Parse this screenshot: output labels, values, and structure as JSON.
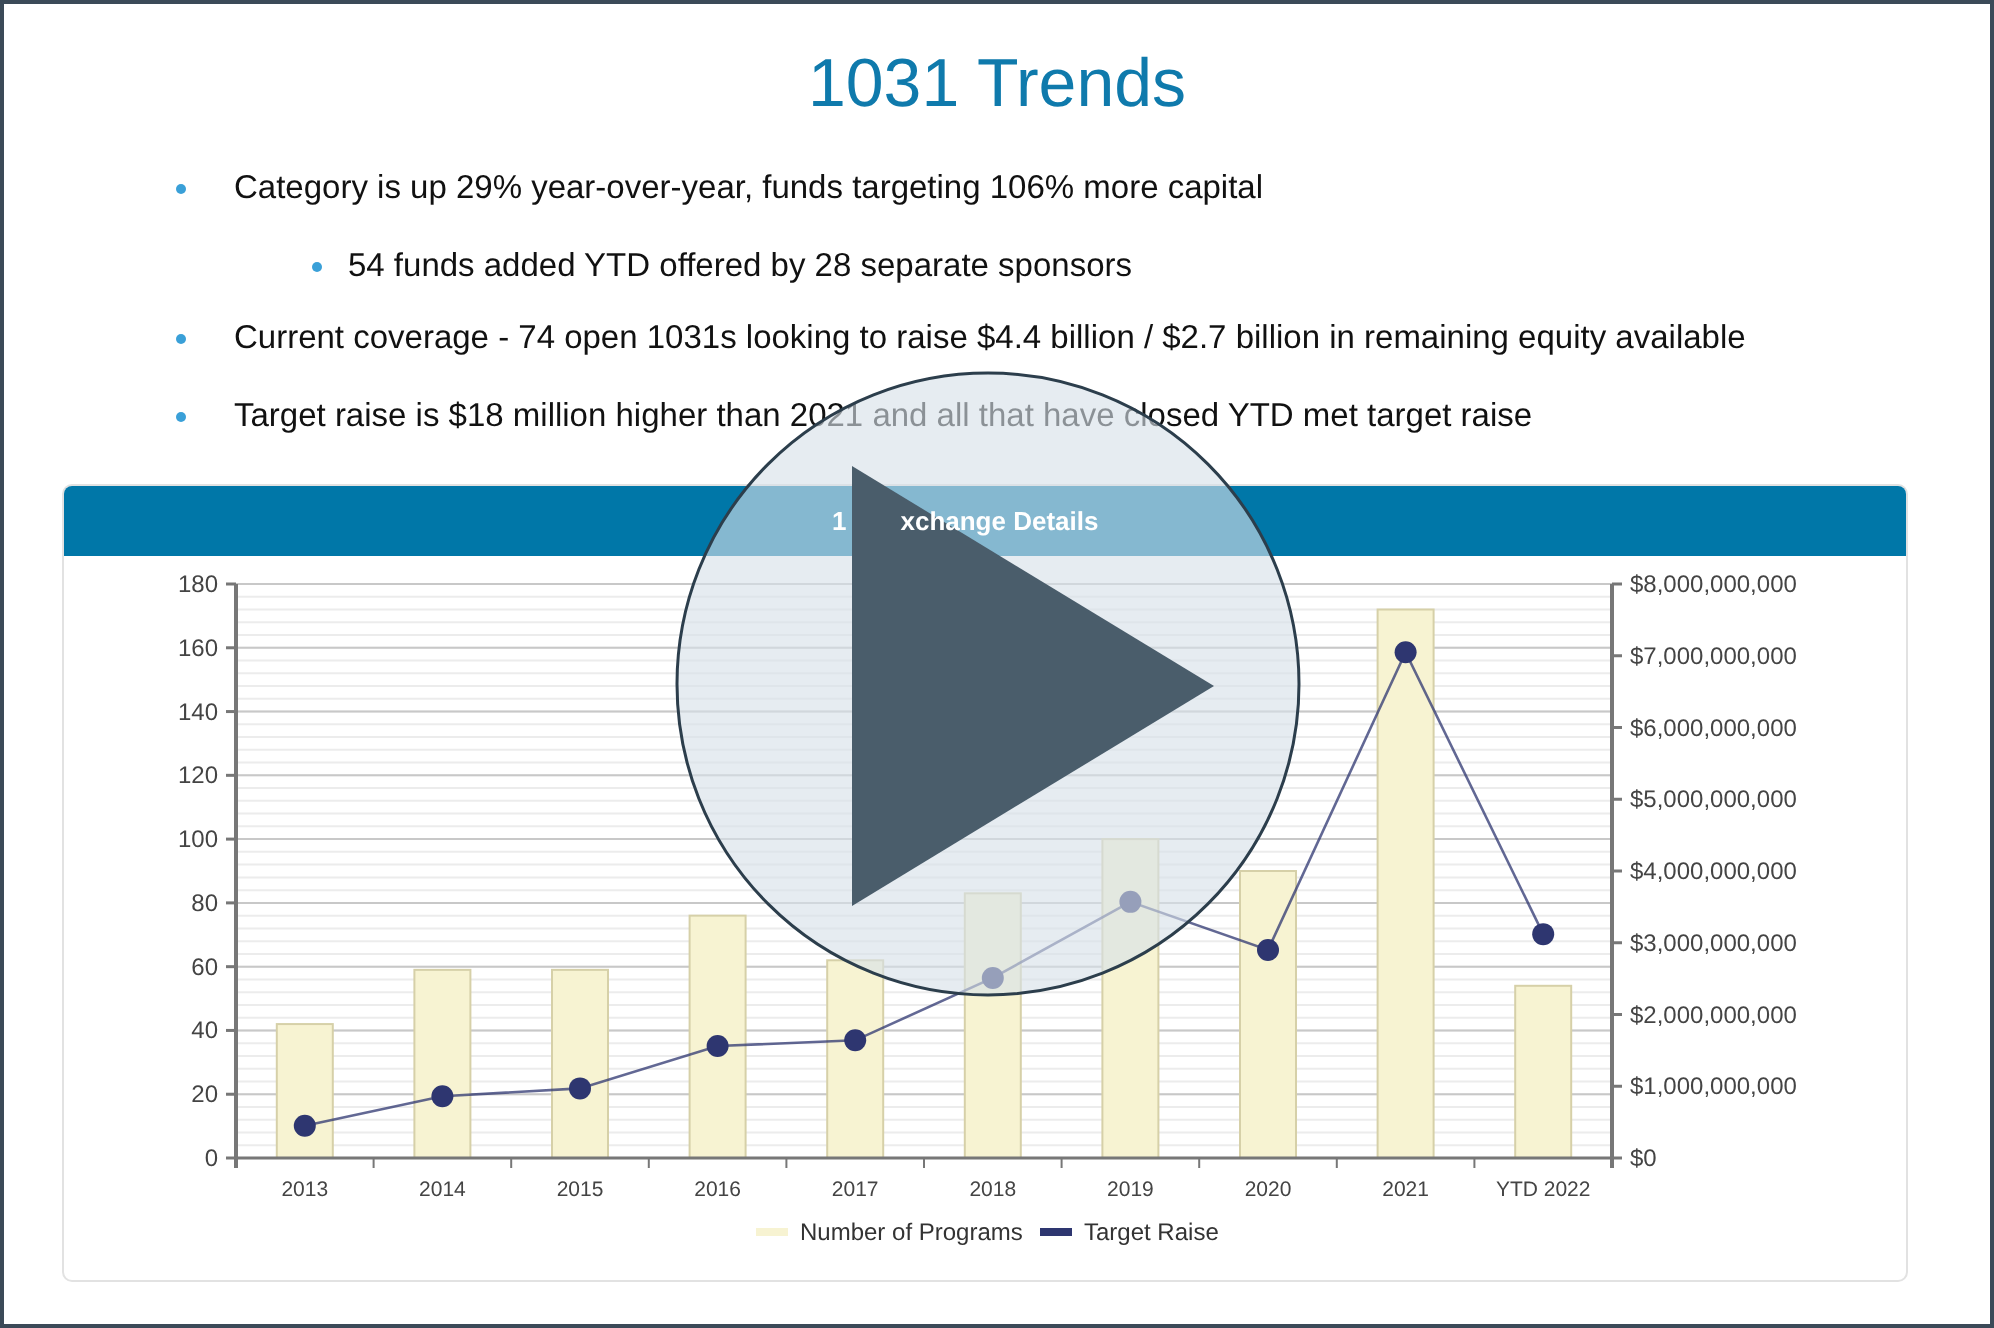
{
  "slide": {
    "title": "1031 Trends",
    "bullets": [
      {
        "text": "Category is up 29% year-over-year, funds targeting 106% more capital",
        "children": [
          {
            "text": "54 funds added YTD offered by 28 separate sponsors"
          }
        ]
      },
      {
        "text": "Current coverage - 74 open 1031s looking to raise $4.4 billion / $2.7 billion in remaining equity available"
      },
      {
        "text": "Target raise is $18 million higher than 2021 and all that have closed YTD met target raise"
      }
    ]
  },
  "chart": {
    "header": [
      "1",
      "xchange Details"
    ],
    "chart_data": {
      "type": "bar",
      "categories": [
        "2013",
        "2014",
        "2015",
        "2016",
        "2017",
        "2018",
        "2019",
        "2020",
        "2021",
        "YTD 2022"
      ],
      "series": [
        {
          "name": "Number of Programs",
          "type": "bar",
          "color": "#f7f3d2",
          "values": [
            42,
            59,
            59,
            76,
            62,
            83,
            100,
            90,
            172,
            54
          ]
        },
        {
          "name": "Target Raise",
          "type": "line",
          "axis": "y2",
          "marker": "circle",
          "color": "#2e3670",
          "values": [
            450000000,
            860000000,
            970000000,
            1560000000,
            1640000000,
            2510000000,
            3570000000,
            2900000000,
            7050000000,
            3120000000
          ]
        }
      ],
      "grid": true,
      "legend": "bottom",
      "ylim": [
        0,
        180
      ],
      "yticks": [
        0,
        20,
        40,
        60,
        80,
        100,
        120,
        140,
        160,
        180
      ],
      "y2lim": [
        0,
        8000000000
      ],
      "y2ticks": [
        {
          "value": 0,
          "label": "$0"
        },
        {
          "value": 1000000000,
          "label": "$1,000,000,000"
        },
        {
          "value": 2000000000,
          "label": "$2,000,000,000"
        },
        {
          "value": 3000000000,
          "label": "$3,000,000,000"
        },
        {
          "value": 4000000000,
          "label": "$4,000,000,000"
        },
        {
          "value": 5000000000,
          "label": "$5,000,000,000"
        },
        {
          "value": 6000000000,
          "label": "$6,000,000,000"
        },
        {
          "value": 7000000000,
          "label": "$7,000,000,000"
        },
        {
          "value": 8000000000,
          "label": "$8,000,000,000"
        }
      ]
    }
  }
}
